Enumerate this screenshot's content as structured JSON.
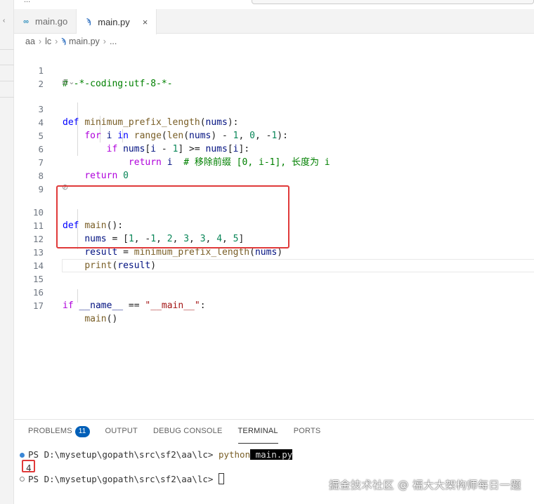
{
  "title_fragment": {
    "left_text": "...",
    "right_text": ""
  },
  "tabs": [
    {
      "label": "main.go",
      "icon": "go-file-icon",
      "active": false
    },
    {
      "label": "main.py",
      "icon": "python-file-icon",
      "active": true,
      "close": "×"
    }
  ],
  "breadcrumb": {
    "folder1": "aa",
    "folder2": "lc",
    "file": "main.py",
    "more": "..."
  },
  "code_lines": [
    {
      "n": "1",
      "text": "# -*-coding:utf-8-*-"
    },
    {
      "n": "2",
      "text": ""
    },
    {
      "n": "3",
      "text": "def minimum_prefix_length(nums):"
    },
    {
      "n": "4",
      "text": "    for i in range(len(nums) - 1, 0, -1):"
    },
    {
      "n": "5",
      "text": "        if nums[i - 1] >= nums[i]:"
    },
    {
      "n": "6",
      "text": "            return i  # 移除前缀 [0, i-1], 长度为 i"
    },
    {
      "n": "7",
      "text": "    return 0"
    },
    {
      "n": "8",
      "text": ""
    },
    {
      "n": "9",
      "text": ""
    },
    {
      "n": "10",
      "text": "def main():"
    },
    {
      "n": "11",
      "text": "    nums = [1, -1, 2, 3, 3, 4, 5]"
    },
    {
      "n": "12",
      "text": "    result = minimum_prefix_length(nums)"
    },
    {
      "n": "13",
      "text": "    print(result)"
    },
    {
      "n": "14",
      "text": ""
    },
    {
      "n": "15",
      "text": ""
    },
    {
      "n": "16",
      "text": "if __name__ == \"__main__\":"
    },
    {
      "n": "17",
      "text": "    main()"
    }
  ],
  "codelens_glyph": "⊘⌄",
  "panel": {
    "tabs": [
      {
        "label": "PROBLEMS",
        "badge": "11"
      },
      {
        "label": "OUTPUT"
      },
      {
        "label": "DEBUG CONSOLE"
      },
      {
        "label": "TERMINAL",
        "active": true
      },
      {
        "label": "PORTS"
      }
    ],
    "terminal": {
      "prompt1": "PS D:\\mysetup\\gopath\\src\\sf2\\aa\\lc> ",
      "cmd": "python",
      "cmd_arg": " main.py",
      "output": "4",
      "prompt2": "PS D:\\mysetup\\gopath\\src\\sf2\\aa\\lc> "
    }
  },
  "watermark": "掘金技术社区 @ 福大大架构师每日一题",
  "colors": {
    "highlight": "#e03a3a",
    "badge": "#005fb8",
    "keyword": "#0000ff",
    "function": "#795e26"
  }
}
